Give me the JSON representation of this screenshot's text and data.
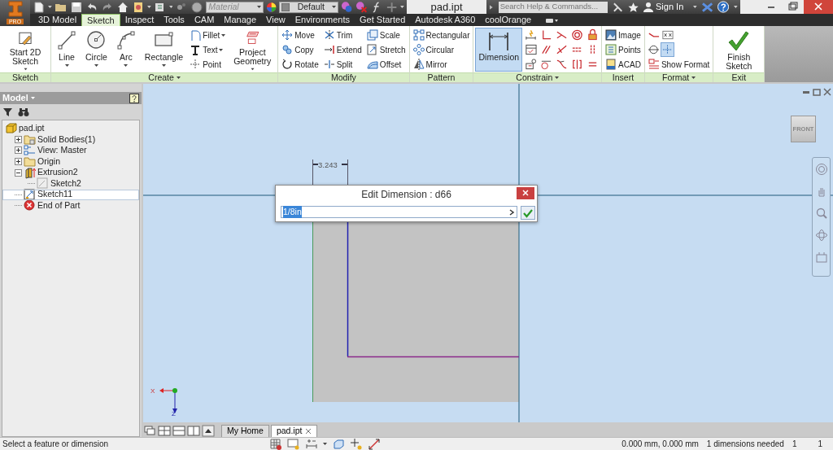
{
  "app": {
    "badge": "PRO"
  },
  "quick_access": {
    "material": {
      "placeholder": "Material"
    },
    "appearance": {
      "value": "Default"
    }
  },
  "title": "pad.ipt",
  "search": {
    "placeholder": "Search Help & Commands..."
  },
  "sign_in": "Sign In",
  "tabs": [
    {
      "label": "3D Model",
      "selected": false
    },
    {
      "label": "Sketch",
      "selected": true
    },
    {
      "label": "Inspect",
      "selected": false
    },
    {
      "label": "Tools",
      "selected": false
    },
    {
      "label": "CAM",
      "selected": false
    },
    {
      "label": "Manage",
      "selected": false
    },
    {
      "label": "View",
      "selected": false
    },
    {
      "label": "Environments",
      "selected": false
    },
    {
      "label": "Get Started",
      "selected": false
    },
    {
      "label": "Autodesk A360",
      "selected": false
    },
    {
      "label": "coolOrange",
      "selected": false
    }
  ],
  "ribbon": [
    {
      "label": "Sketch",
      "has_menu": false,
      "columns": [
        [
          {
            "kind": "large",
            "label": "Start 2D Sketch",
            "dropdown": true,
            "selected": false
          }
        ]
      ]
    },
    {
      "label": "Create",
      "has_menu": true,
      "columns": [
        [
          {
            "kind": "large",
            "label": "Line",
            "dropdown": true,
            "selected": false
          }
        ],
        [
          {
            "kind": "large",
            "label": "Circle",
            "dropdown": true,
            "selected": false
          }
        ],
        [
          {
            "kind": "large",
            "label": "Arc",
            "dropdown": true,
            "selected": false
          }
        ],
        [
          {
            "kind": "large",
            "label": "Rectangle",
            "dropdown": true,
            "selected": false
          }
        ],
        [
          {
            "kind": "small",
            "label": "Fillet",
            "dropdown": true
          },
          {
            "kind": "small",
            "label": "Text",
            "dropdown": true
          },
          {
            "kind": "small",
            "label": "Point",
            "dropdown": false
          }
        ],
        [
          {
            "kind": "large",
            "label": "Project Geometry",
            "dropdown": true,
            "selected": false
          }
        ]
      ]
    },
    {
      "label": "Modify",
      "has_menu": false,
      "columns": [
        [
          {
            "kind": "small",
            "label": "Move",
            "dropdown": false
          },
          {
            "kind": "small",
            "label": "Copy",
            "dropdown": false
          },
          {
            "kind": "small",
            "label": "Rotate",
            "dropdown": false
          }
        ],
        [
          {
            "kind": "small",
            "label": "Trim",
            "dropdown": false
          },
          {
            "kind": "small",
            "label": "Extend",
            "dropdown": false
          },
          {
            "kind": "small",
            "label": "Split",
            "dropdown": false
          }
        ],
        [
          {
            "kind": "small",
            "label": "Scale",
            "dropdown": false
          },
          {
            "kind": "small",
            "label": "Stretch",
            "dropdown": false
          },
          {
            "kind": "small",
            "label": "Offset",
            "dropdown": false
          }
        ]
      ]
    },
    {
      "label": "Pattern",
      "has_menu": false,
      "columns": [
        [
          {
            "kind": "small",
            "label": "Rectangular",
            "dropdown": false
          },
          {
            "kind": "small",
            "label": "Circular",
            "dropdown": false
          },
          {
            "kind": "small",
            "label": "Mirror",
            "dropdown": false
          }
        ]
      ]
    },
    {
      "label": "Constrain",
      "has_menu": true,
      "columns": [
        [
          {
            "kind": "large",
            "label": "Dimension",
            "dropdown": false,
            "selected": true
          }
        ],
        [
          {
            "kind": "icon"
          },
          {
            "kind": "icon"
          },
          {
            "kind": "icon"
          }
        ],
        [
          {
            "kind": "icon"
          },
          {
            "kind": "icon"
          },
          {
            "kind": "icon"
          }
        ],
        [
          {
            "kind": "icon"
          },
          {
            "kind": "icon"
          },
          {
            "kind": "icon"
          }
        ],
        [
          {
            "kind": "icon"
          },
          {
            "kind": "icon"
          },
          {
            "kind": "icon"
          }
        ],
        [
          {
            "kind": "icon"
          },
          {
            "kind": "icon"
          },
          {
            "kind": "icon"
          }
        ]
      ]
    },
    {
      "label": "Insert",
      "has_menu": false,
      "columns": [
        [
          {
            "kind": "small",
            "label": "Image",
            "dropdown": false
          },
          {
            "kind": "small",
            "label": "Points",
            "dropdown": false
          },
          {
            "kind": "small",
            "label": "ACAD",
            "dropdown": false
          }
        ]
      ]
    },
    {
      "label": "Format",
      "has_menu": true,
      "columns": [
        [
          {
            "kind": "group",
            "items": [
              {
                "kind": "toggle",
                "selected": false
              },
              {
                "kind": "toggle",
                "selected": false
              }
            ]
          },
          {
            "kind": "group",
            "items": [
              {
                "kind": "toggle",
                "selected": false
              },
              {
                "kind": "toggle",
                "selected": true
              }
            ]
          },
          {
            "kind": "small",
            "label": "Show Format",
            "dropdown": false
          }
        ]
      ]
    },
    {
      "label": "Exit",
      "has_menu": false,
      "columns": [
        [
          {
            "kind": "large",
            "label": "Finish Sketch",
            "dropdown": false,
            "selected": false
          }
        ]
      ]
    }
  ],
  "browser": {
    "title": "Model",
    "tree": [
      {
        "label": "pad.ipt",
        "selected": false,
        "children": [
          {
            "label": "Solid Bodies(1)",
            "selected": false,
            "expanded": false
          },
          {
            "label": "View: Master",
            "selected": false,
            "expanded": false
          },
          {
            "label": "Origin",
            "selected": false,
            "expanded": false
          },
          {
            "label": "Extrusion2",
            "selected": false,
            "expanded": true,
            "children": [
              {
                "label": "Sketch2",
                "selected": false
              }
            ]
          },
          {
            "label": "Sketch11",
            "selected": true
          },
          {
            "label": "End of Part",
            "selected": false
          }
        ]
      }
    ]
  },
  "canvas": {
    "dimension": "3.243",
    "viewcube": "FRONT",
    "axes": [
      "X",
      "Z"
    ]
  },
  "dialog": {
    "title": "Edit Dimension : d66",
    "value": "1/8in",
    "value_selected": true
  },
  "doc_tabs": [
    {
      "label": "My Home",
      "selected": false
    },
    {
      "label": "pad.ipt",
      "selected": true
    }
  ],
  "status_bar": {
    "message": "Select a feature or dimension",
    "coordinates": "0.000 mm, 0.000 mm",
    "hint": "1 dimensions needed",
    "field_1": "1",
    "field_2": "1"
  }
}
